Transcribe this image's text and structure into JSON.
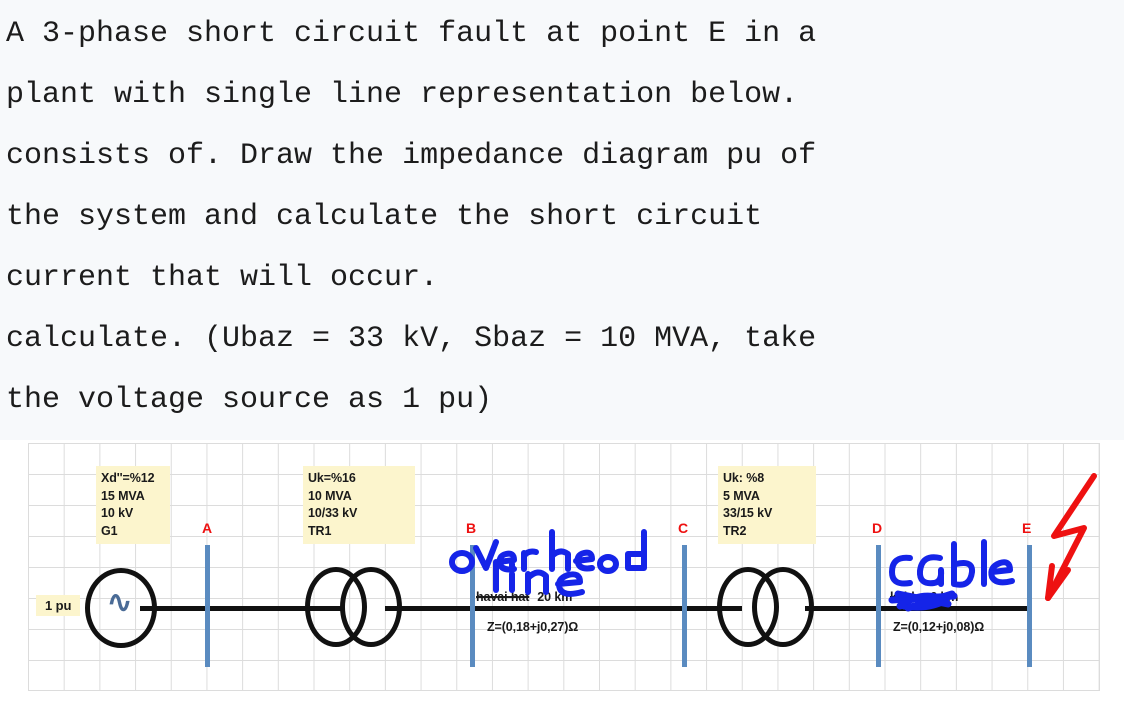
{
  "question": {
    "lines": [
      "A 3-phase short circuit fault at point E in a",
      "plant with single line representation below.",
      "consists of. Draw the impedance diagram pu of",
      "the system and calculate the short circuit",
      "current that will occur.",
      "calculate. (Ubaz = 33 kV, Sbaz = 10 MVA, take",
      "the voltage source as 1 pu)"
    ]
  },
  "diagram": {
    "source_label": "1 pu",
    "generator_symbol": "∿",
    "notes": [
      {
        "id": "g1",
        "text": "Xd''=%12\n15 MVA\n10 kV\nG1"
      },
      {
        "id": "tr1",
        "text": "Uk=%16\n10 MVA\n10/33 kV\nTR1"
      },
      {
        "id": "tr2",
        "text": "Uk: %8\n5 MVA\n33/15 kV\nTR2"
      }
    ],
    "buses": [
      {
        "label": "A"
      },
      {
        "label": "B"
      },
      {
        "label": "C"
      },
      {
        "label": "D"
      },
      {
        "label": "E"
      }
    ],
    "overhead_line": {
      "struck_label": "havai hat",
      "length": "20 km",
      "impedance": "Z=(0,18+j0,27)Ω",
      "handwriting_line1": "overhead",
      "handwriting_line2": "line"
    },
    "cable": {
      "struck_label": "kablo",
      "length": "6 km",
      "impedance": "Z=(0,12+j0,08)Ω",
      "handwriting": "cable"
    },
    "fault_marker": "lightning-bolt",
    "colors": {
      "bus": "#5a8bc0",
      "bus_label": "#ee1111",
      "note_bg": "#fcf5cd",
      "handwriting": "#1524e8",
      "fault": "#ee1111",
      "wire": "#111111"
    }
  }
}
